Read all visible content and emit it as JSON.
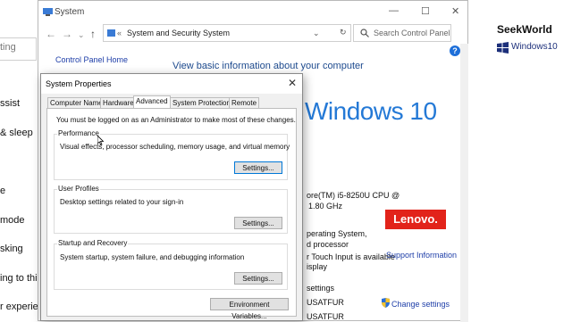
{
  "bg_settings": {
    "search_placeholder": "ting",
    "items": [
      "ssist",
      "& sleep",
      "e",
      "mode",
      "sking",
      "ing to this",
      "r experienc"
    ]
  },
  "brand": {
    "title": "SeekWorld",
    "subtitle": "Windows10"
  },
  "system_window": {
    "title": "System",
    "window_controls": {
      "minimize": "—",
      "maximize": "☐",
      "close": "✕"
    },
    "nav": {
      "back": "←",
      "forward": "→",
      "up": "↑",
      "refresh": "↻",
      "dropdown": "⌄"
    },
    "breadcrumb": {
      "separator": "«",
      "path": [
        "System and Security",
        "System"
      ],
      "arrow": "›"
    },
    "search_placeholder": "Search Control Panel",
    "help": "?",
    "cp_home": "Control Panel Home",
    "heading": "View basic information about your computer",
    "windows_logo_text": "Windows 10",
    "info_lines": [
      "ore(TM) i5-8250U CPU @",
      "1.80 GHz",
      "perating System,",
      "d processor",
      "r Touch Input is available",
      "isplay",
      "settings",
      "USATFUR",
      "USATFUR"
    ],
    "oem_logo": "Lenovo.",
    "support_link": "Support Information",
    "change_settings": "Change settings"
  },
  "dialog": {
    "title": "System Properties",
    "close": "✕",
    "tabs": [
      "Computer Name",
      "Hardware",
      "Advanced",
      "System Protection",
      "Remote"
    ],
    "active_tab": "Advanced",
    "note": "You must be logged on as an Administrator to make most of these changes.",
    "performance": {
      "title": "Performance",
      "desc": "Visual effects, processor scheduling, memory usage, and virtual memory",
      "button": "Settings..."
    },
    "user_profiles": {
      "title": "User Profiles",
      "desc": "Desktop settings related to your sign-in",
      "button": "Settings..."
    },
    "startup": {
      "title": "Startup and Recovery",
      "desc": "System startup, system failure, and debugging information",
      "button": "Settings..."
    },
    "env_button": "Environment Variables..."
  },
  "colors": {
    "link": "#1e3ea8",
    "heading": "#1d4a8e",
    "windows_blue": "#2479d6",
    "lenovo_red": "#e2231a"
  }
}
